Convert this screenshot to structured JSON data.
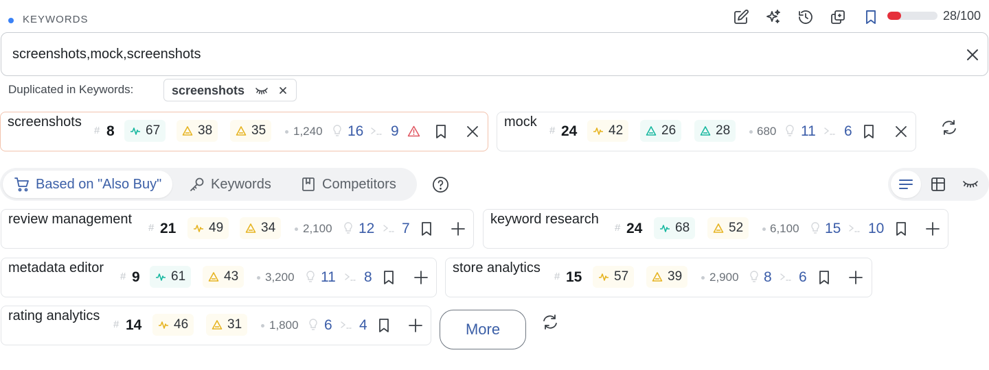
{
  "header": {
    "label": "KEYWORDS",
    "progress_text": "28/100",
    "progress_fraction": 0.28,
    "tools": [
      "edit-icon",
      "sparkles-icon",
      "history-icon",
      "copy-icon",
      "bookmark-icon"
    ]
  },
  "input": {
    "value": "screenshots,mock,screenshots"
  },
  "duplicates": {
    "label": "Duplicated in Keywords:",
    "chips": [
      "screenshots"
    ]
  },
  "tracked": [
    {
      "name": "screenshots",
      "rank": "8",
      "score": "67",
      "difficulty": "38",
      "competition": "35",
      "volume": "1,240",
      "ideas": "16",
      "results": "9",
      "warning": true
    },
    {
      "name": "mock",
      "rank": "24",
      "score": "42",
      "difficulty": "26",
      "competition": "28",
      "volume": "680",
      "ideas": "11",
      "results": "6",
      "warning": false
    }
  ],
  "tabs": [
    {
      "label": "Based on \"Also Buy\"",
      "icon": "cart-icon",
      "active": true
    },
    {
      "label": "Keywords",
      "icon": "key-icon",
      "active": false
    },
    {
      "label": "Competitors",
      "icon": "book-icon",
      "active": false
    }
  ],
  "views": [
    "list-view-icon",
    "grid-view-icon",
    "hidden-view-icon"
  ],
  "suggestions": [
    {
      "name": "review management",
      "rank": "21",
      "score": "49",
      "difficulty": "34",
      "volume": "2,100",
      "ideas": "12",
      "results": "7"
    },
    {
      "name": "keyword research",
      "rank": "24",
      "score": "68",
      "difficulty": "52",
      "volume": "6,100",
      "ideas": "15",
      "results": "10"
    },
    {
      "name": "metadata editor",
      "rank": "9",
      "score": "61",
      "difficulty": "43",
      "volume": "3,200",
      "ideas": "11",
      "results": "8"
    },
    {
      "name": "store analytics",
      "rank": "15",
      "score": "57",
      "difficulty": "39",
      "volume": "2,900",
      "ideas": "8",
      "results": "6"
    },
    {
      "name": "rating analytics",
      "rank": "14",
      "score": "46",
      "difficulty": "31",
      "volume": "1,800",
      "ideas": "6",
      "results": "4"
    }
  ],
  "more_label": "More",
  "colors": {
    "accent": "#3b5fa7",
    "progress": "#e5303b",
    "green": "#18b8a0",
    "yellow": "#e6b422"
  }
}
